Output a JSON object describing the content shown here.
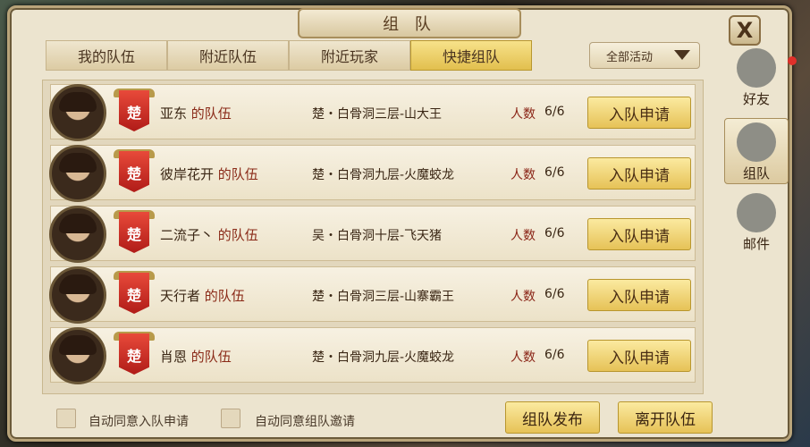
{
  "window": {
    "title": "组 队",
    "close_label": "X"
  },
  "tabs": [
    {
      "label": "我的队伍"
    },
    {
      "label": "附近队伍"
    },
    {
      "label": "附近玩家"
    },
    {
      "label": "快捷组队"
    }
  ],
  "filter": {
    "label": "全部活动"
  },
  "teams": [
    {
      "leader": "亚东",
      "suffix": "的队伍",
      "faction": "楚",
      "location": "楚・白骨洞三层-山大王",
      "count_label": "人数",
      "count": "6/6",
      "action": "入队申请"
    },
    {
      "leader": "彼岸花开",
      "suffix": "的队伍",
      "faction": "楚",
      "location": "楚・白骨洞九层-火魔蛟龙",
      "count_label": "人数",
      "count": "6/6",
      "action": "入队申请"
    },
    {
      "leader": "二流子丶",
      "suffix": "的队伍",
      "faction": "楚",
      "location": "吴・白骨洞十层-飞天猪",
      "count_label": "人数",
      "count": "6/6",
      "action": "入队申请"
    },
    {
      "leader": "天行者",
      "suffix": "的队伍",
      "faction": "楚",
      "location": "楚・白骨洞三层-山寨霸王",
      "count_label": "人数",
      "count": "6/6",
      "action": "入队申请"
    },
    {
      "leader": "肖恩",
      "suffix": "的队伍",
      "faction": "楚",
      "location": "楚・白骨洞九层-火魔蛟龙",
      "count_label": "人数",
      "count": "6/6",
      "action": "入队申请"
    }
  ],
  "footer": {
    "auto_accept_join": "自动同意入队申请",
    "auto_accept_invite": "自动同意组队邀请",
    "publish_button": "组队发布",
    "leave_button": "离开队伍"
  },
  "sidebar": [
    {
      "label": "好友",
      "icon": "friends-icon"
    },
    {
      "label": "组队",
      "icon": "team-icon"
    },
    {
      "label": "邮件",
      "icon": "mail-icon"
    }
  ],
  "colors": {
    "accent": "#e6c257",
    "banner": "#c8231d",
    "panel": "#ece4cf"
  }
}
